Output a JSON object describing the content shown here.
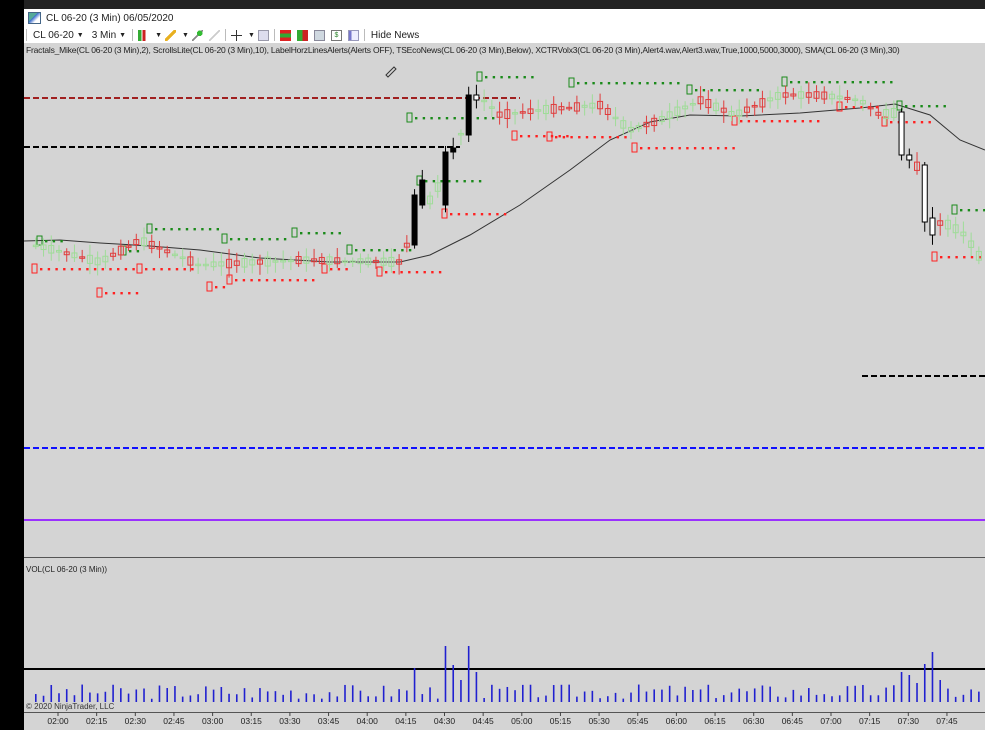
{
  "window": {
    "title": "CL 06-20 (3 Min)  06/05/2020"
  },
  "toolbar": {
    "instrument": "CL 06-20",
    "interval": "3 Min",
    "icons": [
      "bar-type-icon",
      "drawing-tool-icon",
      "pin-icon",
      "pin-disabled-icon",
      "crosshair-icon",
      "zoom-icon",
      "strategies-icon",
      "indicators-icon",
      "chart-trader-icon",
      "dollar-icon",
      "properties-icon"
    ],
    "hide_news": "Hide News"
  },
  "price_panel": {
    "indicators": "Fractals_Mike(CL 06-20 (3 Min),2), ScrollsLite(CL 06-20 (3 Min),10), LabelHorzLinesAlerts(Alerts OFF), TSEcoNews(CL 06-20 (3 Min),Below), XCTRVolx3(CL 06-20 (3 Min),Alert4.wav,Alert3.wav,True,1000,5000,3000), SMA(CL 06-20 (3 Min),30)"
  },
  "volume_panel": {
    "label": "VOL(CL 06-20 (3 Min))"
  },
  "copyright": "© 2020 NinjaTrader, LLC",
  "time_axis": [
    "02:00",
    "02:15",
    "02:30",
    "02:45",
    "03:00",
    "03:15",
    "03:30",
    "03:45",
    "04:00",
    "04:15",
    "04:30",
    "04:45",
    "05:00",
    "05:15",
    "05:30",
    "05:45",
    "06:00",
    "06:15",
    "06:30",
    "06:45",
    "07:00",
    "07:15",
    "07:30",
    "07:45"
  ],
  "colors": {
    "background": "#d4d4d4",
    "up_candle": "#9fdc98",
    "down_candle": "#e03c3c",
    "fractal_high": "#1a8a1a",
    "fractal_low": "#ff2020",
    "sma": "#333333",
    "volume": "#2020d0",
    "line_darkred": "#a02020",
    "line_blue": "#1010ff",
    "line_purple": "#9a30ff"
  }
}
